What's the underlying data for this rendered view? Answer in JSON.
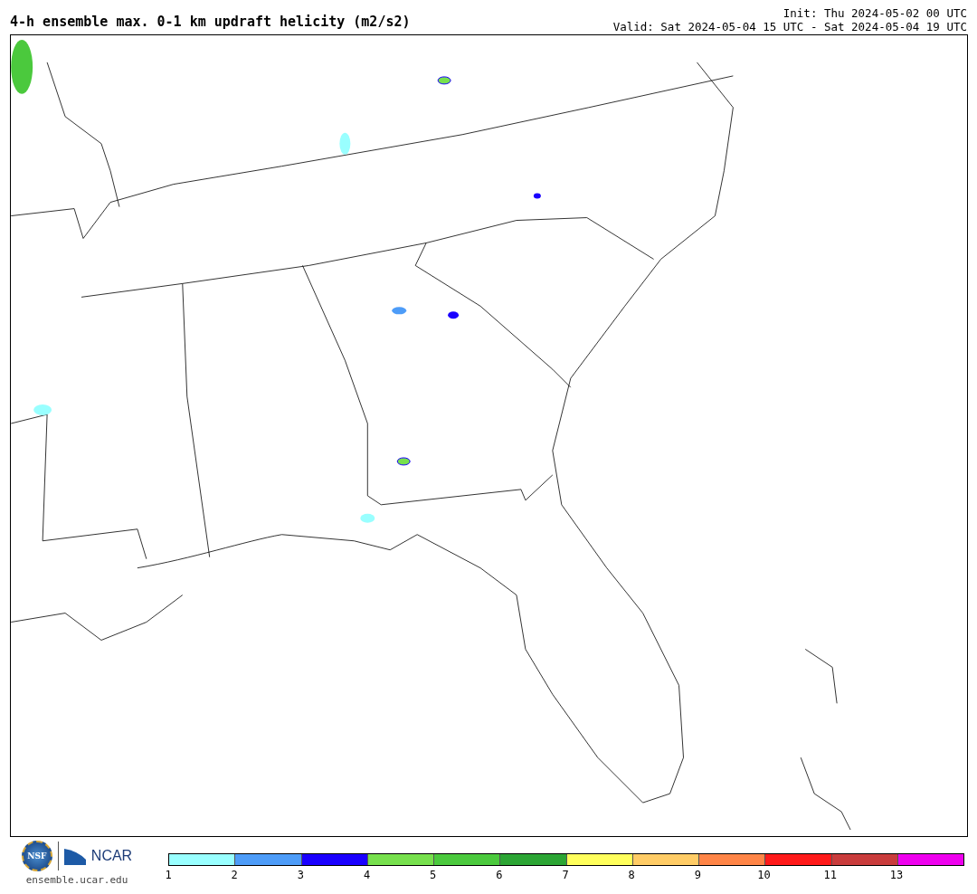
{
  "title": "4-h ensemble max. 0-1 km updraft helicity (m2/s2)",
  "init": "Init: Thu 2024-05-02 00 UTC",
  "valid": "Valid: Sat 2024-05-04 15 UTC - Sat 2024-05-04 19 UTC",
  "logos": {
    "nsf": "NSF",
    "ncar": "NCAR",
    "url": "ensemble.ucar.edu"
  },
  "colorbar": [
    {
      "label": "1",
      "color": "#99ffff"
    },
    {
      "label": "2",
      "color": "#4d9cf8"
    },
    {
      "label": "3",
      "color": "#1a00ff"
    },
    {
      "label": "4",
      "color": "#77e04d"
    },
    {
      "label": "5",
      "color": "#4bc93d"
    },
    {
      "label": "6",
      "color": "#2ca534"
    },
    {
      "label": "7",
      "color": "#ffff5c"
    },
    {
      "label": "8",
      "color": "#ffcc66"
    },
    {
      "label": "9",
      "color": "#ff8547"
    },
    {
      "label": "10",
      "color": "#ff1a1a"
    },
    {
      "label": "11",
      "color": "#c93c3c"
    },
    {
      "label": "13",
      "color": "#ee00ee"
    }
  ]
}
